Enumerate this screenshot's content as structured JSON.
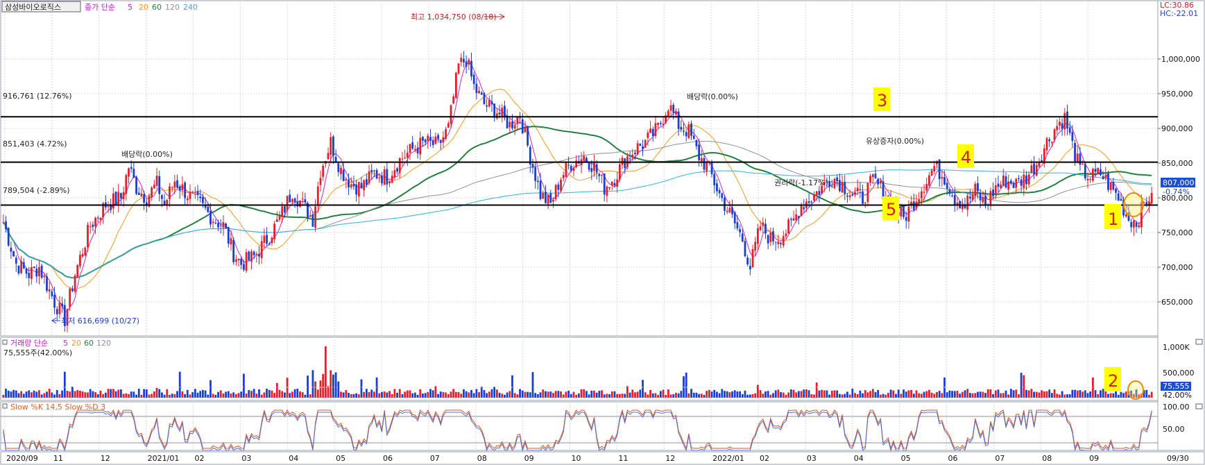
{
  "title_bar": {
    "stock_name": "삼성바이오로직스",
    "price_legend": "종가 단순",
    "ma_periods": [
      "5",
      "20",
      "60",
      "120",
      "240"
    ],
    "lc": "LC:30.86",
    "hc": "HC:-22.01"
  },
  "colors": {
    "up": "#e0202a",
    "down": "#1a3fd0",
    "ma5": "#d020d0",
    "ma20": "#f09a20",
    "ma60": "#208040",
    "ma120": "#909090",
    "ma240": "#30b0e0",
    "annotation_bg": "#ffff00",
    "grid": "#d8d8d8"
  },
  "annotations": {
    "high": "최고 1,034,750 (08/18)",
    "low": "최저 616,699 (10/27)",
    "dividend1": "배당락(0.00%)",
    "dividend2": "배당락(0.00%)",
    "rights_issue": "유상증자(0.00%)",
    "rights_drop": "권리락(-1.17%)",
    "marker_labels": [
      "1",
      "2",
      "3",
      "4",
      "5"
    ]
  },
  "current_price": {
    "price": "807,000",
    "change": "-0.74%"
  },
  "volume_panel": {
    "title": "거래량 단순",
    "ma_periods": [
      "5",
      "20",
      "60",
      "120"
    ],
    "summary": "75,555주(42.00%)",
    "current": "75,555",
    "current_pct": "42.00%",
    "axis_labels": [
      "1,000K",
      "500,000"
    ]
  },
  "stoch_panel": {
    "title": "Slow %K 14,5  Slow %D 3",
    "axis_labels": [
      "100.00",
      "50.00"
    ]
  },
  "chart_data": {
    "type": "candlestick",
    "price_axis_labels": [
      "1,000,000",
      "950,000",
      "900,000",
      "850,000",
      "800,000",
      "750,000",
      "700,000",
      "650,000"
    ],
    "price_axis_range": [
      605000,
      1055000
    ],
    "date_labels": [
      "2020/09",
      "11",
      "12",
      "2021/01",
      "02",
      "03",
      "04",
      "05",
      "06",
      "07",
      "08",
      "09",
      "10",
      "11",
      "12",
      "2022/01",
      "02",
      "03",
      "04",
      "05",
      "06",
      "07",
      "08",
      "09"
    ],
    "last_date_label": "09/30",
    "horizontal_lines": [
      {
        "label": "916,761 (12.76%)",
        "value": 916761
      },
      {
        "label": "851,403 (4.72%)",
        "value": 851403
      },
      {
        "label": "789,504 (-2.89%)",
        "value": 789504
      }
    ],
    "high": 1034750,
    "low": 616699,
    "close_key_points": [
      [
        0,
        765000
      ],
      [
        5,
        705000
      ],
      [
        10,
        690000
      ],
      [
        14,
        700000
      ],
      [
        20,
        650000
      ],
      [
        24,
        625000
      ],
      [
        28,
        690000
      ],
      [
        34,
        760000
      ],
      [
        40,
        790000
      ],
      [
        46,
        800000
      ],
      [
        49,
        845000
      ],
      [
        52,
        815000
      ],
      [
        56,
        800000
      ],
      [
        60,
        820000
      ],
      [
        63,
        790000
      ],
      [
        67,
        825000
      ],
      [
        72,
        805000
      ],
      [
        77,
        790000
      ],
      [
        82,
        770000
      ],
      [
        86,
        760000
      ],
      [
        90,
        720000
      ],
      [
        93,
        705000
      ],
      [
        98,
        715000
      ],
      [
        104,
        745000
      ],
      [
        108,
        770000
      ],
      [
        113,
        810000
      ],
      [
        117,
        790000
      ],
      [
        121,
        770000
      ],
      [
        124,
        840000
      ],
      [
        128,
        880000
      ],
      [
        132,
        840000
      ],
      [
        136,
        820000
      ],
      [
        140,
        815000
      ],
      [
        145,
        835000
      ],
      [
        150,
        830000
      ],
      [
        155,
        855000
      ],
      [
        160,
        870000
      ],
      [
        165,
        880000
      ],
      [
        170,
        875000
      ],
      [
        174,
        900000
      ],
      [
        178,
        990000
      ],
      [
        181,
        1000000
      ],
      [
        184,
        960000
      ],
      [
        188,
        935000
      ],
      [
        193,
        925000
      ],
      [
        198,
        905000
      ],
      [
        202,
        920000
      ],
      [
        206,
        860000
      ],
      [
        210,
        805000
      ],
      [
        214,
        790000
      ],
      [
        218,
        830000
      ],
      [
        222,
        850000
      ],
      [
        227,
        860000
      ],
      [
        231,
        845000
      ],
      [
        235,
        815000
      ],
      [
        239,
        830000
      ],
      [
        243,
        855000
      ],
      [
        247,
        870000
      ],
      [
        251,
        880000
      ],
      [
        256,
        900000
      ],
      [
        260,
        935000
      ],
      [
        264,
        905000
      ],
      [
        268,
        895000
      ],
      [
        272,
        860000
      ],
      [
        276,
        840000
      ],
      [
        280,
        805000
      ],
      [
        285,
        770000
      ],
      [
        289,
        740000
      ],
      [
        292,
        700000
      ],
      [
        296,
        760000
      ],
      [
        300,
        740000
      ],
      [
        304,
        745000
      ],
      [
        308,
        760000
      ],
      [
        312,
        790000
      ],
      [
        316,
        800000
      ],
      [
        320,
        815000
      ],
      [
        324,
        830000
      ],
      [
        328,
        820000
      ],
      [
        332,
        805000
      ],
      [
        336,
        800000
      ],
      [
        340,
        825000
      ],
      [
        344,
        810000
      ],
      [
        348,
        790000
      ],
      [
        352,
        770000
      ],
      [
        356,
        795000
      ],
      [
        360,
        820000
      ],
      [
        364,
        845000
      ],
      [
        368,
        830000
      ],
      [
        372,
        800000
      ],
      [
        376,
        790000
      ],
      [
        380,
        810000
      ],
      [
        384,
        790000
      ],
      [
        388,
        815000
      ],
      [
        392,
        825000
      ],
      [
        396,
        820000
      ],
      [
        400,
        830000
      ],
      [
        404,
        850000
      ],
      [
        408,
        880000
      ],
      [
        412,
        905000
      ],
      [
        415,
        915000
      ],
      [
        418,
        875000
      ],
      [
        421,
        840000
      ],
      [
        425,
        830000
      ],
      [
        429,
        835000
      ],
      [
        432,
        820000
      ],
      [
        436,
        800000
      ],
      [
        440,
        770000
      ],
      [
        443,
        765000
      ],
      [
        446,
        790000
      ],
      [
        449,
        807000
      ]
    ],
    "series": [
      {
        "name": "5",
        "color": "#d020d0"
      },
      {
        "name": "20",
        "color": "#f09a20"
      },
      {
        "name": "60",
        "color": "#208040"
      },
      {
        "name": "120",
        "color": "#909090"
      },
      {
        "name": "240",
        "color": "#30b0e0"
      }
    ]
  }
}
